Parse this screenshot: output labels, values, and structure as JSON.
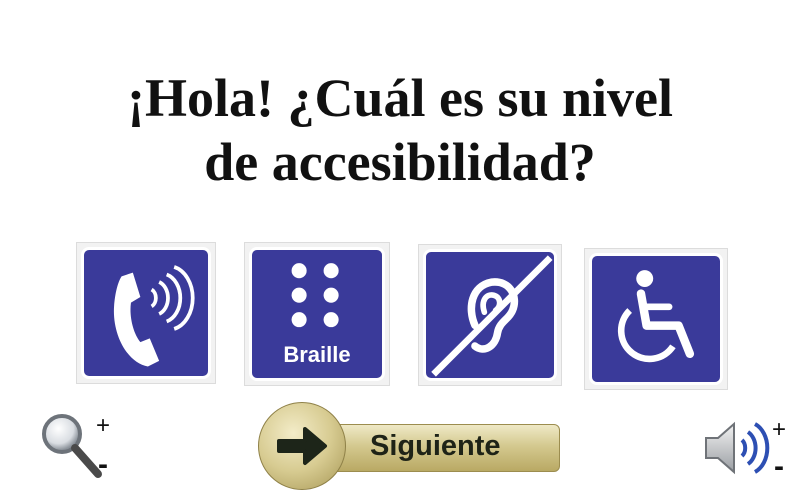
{
  "prompt": {
    "line1": "¡Hola! ¿Cuál es su nivel",
    "line2": "de accesibilidad?"
  },
  "signs": [
    {
      "icon": "phone-volume-icon",
      "label": ""
    },
    {
      "icon": "braille-icon",
      "label": "Braille"
    },
    {
      "icon": "hearing-impaired-icon",
      "label": ""
    },
    {
      "icon": "wheelchair-icon",
      "label": ""
    }
  ],
  "zoom_control": {
    "icon": "magnifier-icon",
    "plus": "+",
    "minus": "-"
  },
  "volume_control": {
    "icon": "speaker-icon",
    "plus": "+",
    "minus": "-"
  },
  "next_button": {
    "label": "Siguiente",
    "icon": "arrow-right-icon"
  },
  "colors": {
    "sign_blue": "#3a3a9a",
    "button_gold": "#d4c98f",
    "text": "#111111"
  }
}
